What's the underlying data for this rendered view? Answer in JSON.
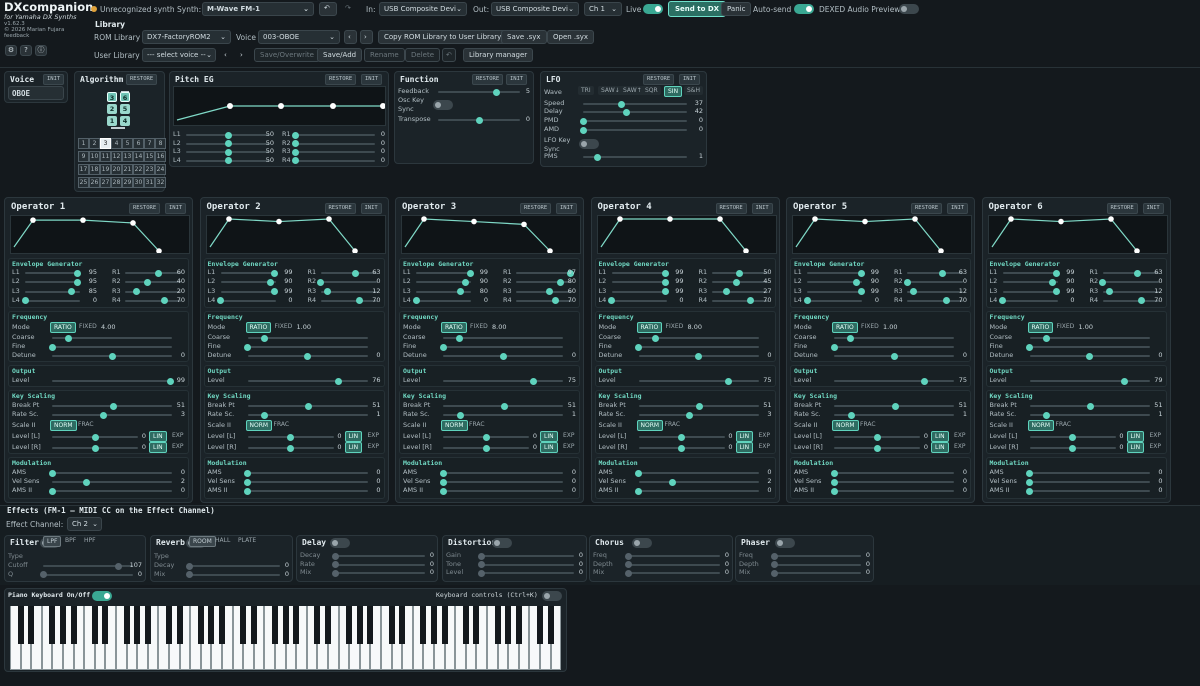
{
  "app": {
    "brand": "DXcompanion",
    "subtitle": "for Yamaha DX Synths",
    "version": "v1.62.3",
    "copyright": "© 2026 Marian Fujara",
    "feedback": "feedback"
  },
  "topbar": {
    "status": "Unrecognized synth",
    "synth_label": "Synth:",
    "synth_value": "M-Wave FM-1",
    "in_label": "In:",
    "in_value": "USB Composite Devic",
    "out_label": "Out:",
    "out_value": "USB Composite Devic",
    "channel": "Ch 1",
    "live_label": "Live",
    "send_label": "Send to DX",
    "panic_label": "Panic",
    "autosend_label": "Auto-send",
    "dexed_label": "DEXED Audio Preview"
  },
  "library": {
    "title": "Library",
    "rom_label": "ROM Library",
    "rom_value": "DX7-FactoryROM2",
    "voice_label": "Voice",
    "voice_value": "003-OBOE",
    "copy_label": "Copy ROM Library to User Library",
    "save_sysx_label": "Save .syx",
    "open_sysx_label": "Open .syx",
    "user_label": "User Library",
    "user_value": "--- select voice ---",
    "save_overwrite_label": "Save/Overwrite",
    "save_add_label": "Save/Add",
    "rename_label": "Rename",
    "delete_label": "Delete",
    "manager_label": "Library manager"
  },
  "voice": {
    "title": "Voice",
    "init": "INIT",
    "name": "OBOE"
  },
  "algorithm": {
    "title": "Algorithm",
    "restore": "RESTORE",
    "selected": 3,
    "ops": [
      "3",
      "6",
      "2",
      "5",
      "1",
      "4"
    ],
    "numbers": [
      "1",
      "2",
      "3",
      "4",
      "5",
      "6",
      "7",
      "8",
      "9",
      "10",
      "11",
      "12",
      "13",
      "14",
      "15",
      "16",
      "17",
      "18",
      "19",
      "20",
      "21",
      "22",
      "23",
      "24",
      "25",
      "26",
      "27",
      "28",
      "29",
      "30",
      "31",
      "32"
    ]
  },
  "pitch_eg": {
    "title": "Pitch EG",
    "restore": "RESTORE",
    "init": "INIT",
    "levels": [
      {
        "label": "L1",
        "value": "50"
      },
      {
        "label": "L2",
        "value": "50"
      },
      {
        "label": "L3",
        "value": "50"
      },
      {
        "label": "L4",
        "value": "50"
      }
    ],
    "rates": [
      {
        "label": "R1",
        "value": "0"
      },
      {
        "label": "R2",
        "value": "0"
      },
      {
        "label": "R3",
        "value": "0"
      },
      {
        "label": "R4",
        "value": "0"
      }
    ]
  },
  "function": {
    "title": "Function",
    "restore": "RESTORE",
    "init": "INIT",
    "feedback_label": "Feedback",
    "feedback_value": "5",
    "osckey_label": "Osc Key",
    "sync_label": "Sync",
    "transpose_label": "Transpose",
    "transpose_value": "0"
  },
  "lfo": {
    "title": "LFO",
    "restore": "RESTORE",
    "init": "INIT",
    "wave_label": "Wave",
    "waves": [
      "TRI",
      "SAW↓",
      "SAW↑",
      "SQR",
      "SIN",
      "S&H"
    ],
    "wave_selected": "SIN",
    "speed_label": "Speed",
    "speed_value": "37",
    "delay_label": "Delay",
    "delay_value": "42",
    "pmd_label": "PMD",
    "pmd_value": "0",
    "amd_label": "AMD",
    "amd_value": "0",
    "lfokey_label": "LFO Key",
    "sync_label": "Sync",
    "pms_label": "PMS",
    "pms_value": "1"
  },
  "op_common": {
    "restore": "RESTORE",
    "init": "INIT",
    "env_title": "Envelope Generator",
    "freq_title": "Frequency",
    "mode_label": "Mode",
    "ratio": "RATIO",
    "fixed": "FIXED",
    "coarse_label": "Coarse",
    "fine_label": "Fine",
    "detune_label": "Detune",
    "out_title": "Output",
    "level_label": "Level",
    "ks_title": "Key Scaling",
    "breakpt_label": "Break Pt",
    "ratesc_label": "Rate Sc.",
    "scale_label": "Scale II",
    "norm": "NORM",
    "frac": "FRAC",
    "levell_label": "Level [L]",
    "levelr_label": "Level [R]",
    "lin": "LIN",
    "exp": "EXP",
    "mod_title": "Modulation",
    "ams_label": "AMS",
    "vel_label": "Vel Sens",
    "ams2_label": "AMS II",
    "lnames": [
      "L1",
      "L2",
      "L3",
      "L4"
    ],
    "rnames": [
      "R1",
      "R2",
      "R3",
      "R4"
    ]
  },
  "operators": [
    {
      "title": "Operator 1",
      "L": [
        "95",
        "95",
        "85",
        "0"
      ],
      "R": [
        "60",
        "40",
        "20",
        "70"
      ],
      "freq": "4.00",
      "detune": "0",
      "level": "99",
      "breakpt": "51",
      "ratesc": "3",
      "levell": "0",
      "levelr": "0",
      "ams": "0",
      "vel": "2",
      "ams2": "0"
    },
    {
      "title": "Operator 2",
      "L": [
        "99",
        "90",
        "99",
        "0"
      ],
      "R": [
        "63",
        "0",
        "12",
        "70"
      ],
      "freq": "1.00",
      "detune": "0",
      "level": "76",
      "breakpt": "51",
      "ratesc": "1",
      "levell": "0",
      "levelr": "0",
      "ams": "0",
      "vel": "0",
      "ams2": "0"
    },
    {
      "title": "Operator 3",
      "L": [
        "99",
        "90",
        "80",
        "0"
      ],
      "R": [
        "97",
        "80",
        "60",
        "70"
      ],
      "freq": "8.00",
      "detune": "0",
      "level": "75",
      "breakpt": "51",
      "ratesc": "1",
      "levell": "0",
      "levelr": "0",
      "ams": "0",
      "vel": "0",
      "ams2": "0"
    },
    {
      "title": "Operator 4",
      "L": [
        "99",
        "99",
        "99",
        "0"
      ],
      "R": [
        "50",
        "45",
        "27",
        "70"
      ],
      "freq": "8.00",
      "detune": "0",
      "level": "75",
      "breakpt": "51",
      "ratesc": "3",
      "levell": "0",
      "levelr": "0",
      "ams": "0",
      "vel": "2",
      "ams2": "0"
    },
    {
      "title": "Operator 5",
      "L": [
        "99",
        "90",
        "99",
        "0"
      ],
      "R": [
        "63",
        "0",
        "12",
        "70"
      ],
      "freq": "1.00",
      "detune": "0",
      "level": "75",
      "breakpt": "51",
      "ratesc": "1",
      "levell": "0",
      "levelr": "0",
      "ams": "0",
      "vel": "0",
      "ams2": "0"
    },
    {
      "title": "Operator 6",
      "L": [
        "99",
        "90",
        "99",
        "0"
      ],
      "R": [
        "63",
        "0",
        "12",
        "70"
      ],
      "freq": "1.00",
      "detune": "0",
      "level": "79",
      "breakpt": "51",
      "ratesc": "1",
      "levell": "0",
      "levelr": "0",
      "ams": "0",
      "vel": "0",
      "ams2": "0"
    }
  ],
  "effects": {
    "title": "Effects (FM-1 — MIDI CC on the Effect Channel)",
    "channel_label": "Effect Channel:",
    "channel_value": "Ch 2",
    "filter": {
      "title": "Filter",
      "type_label": "Type",
      "types": [
        "LPF",
        "BPF",
        "HPF"
      ],
      "cutoff_label": "Cutoff",
      "cutoff_value": "107",
      "q_label": "Q",
      "q_value": "0"
    },
    "reverb": {
      "title": "Reverb",
      "type_label": "Type",
      "types": [
        "ROOM",
        "HALL",
        "PLATE"
      ],
      "decay_label": "Decay",
      "decay_value": "0",
      "mix_label": "Mix",
      "mix_value": "0"
    },
    "delay": {
      "title": "Delay",
      "decay_label": "Decay",
      "decay_value": "0",
      "rate_label": "Rate",
      "rate_value": "0",
      "mix_label": "Mix",
      "mix_value": "0"
    },
    "distortion": {
      "title": "Distortion",
      "gain_label": "Gain",
      "gain_value": "0",
      "tone_label": "Tone",
      "tone_value": "0",
      "level_label": "Level",
      "level_value": "0"
    },
    "chorus": {
      "title": "Chorus",
      "freq_label": "Freq",
      "freq_value": "0",
      "depth_label": "Depth",
      "depth_value": "0",
      "mix_label": "Mix",
      "mix_value": "0"
    },
    "phaser": {
      "title": "Phaser",
      "freq_label": "Freq",
      "freq_value": "0",
      "depth_label": "Depth",
      "depth_value": "0",
      "mix_label": "Mix",
      "mix_value": "0"
    }
  },
  "keyboard": {
    "label": "Piano Keyboard On/Off",
    "controls_label": "Keyboard controls (Ctrl+K)"
  }
}
